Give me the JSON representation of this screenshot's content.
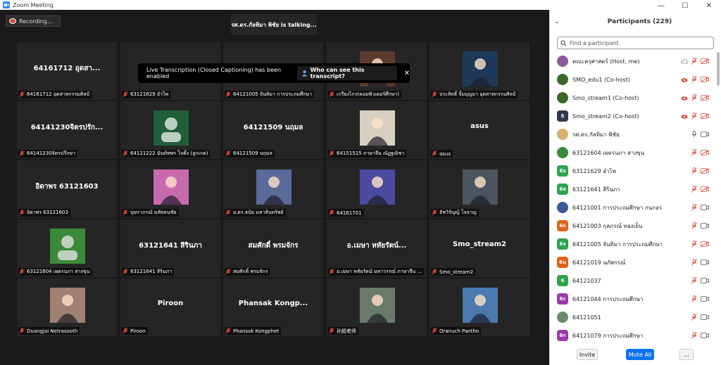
{
  "window": {
    "title": "Zoom Meeting"
  },
  "recording": {
    "label": "Recording..."
  },
  "talking": {
    "text": "รศ.ดร.กัลทิมา พิชัย is  talking..."
  },
  "banner": {
    "text": "Live Transcription (Closed Captioning) has been enabled",
    "link": "Who can see this transcript?"
  },
  "tiles": [
    {
      "big": "64161712 อุดสา...",
      "label": "64161712 อุดสาหกรรมศิลป์"
    },
    {
      "big": "",
      "label": "63121629 อำไพ"
    },
    {
      "big": "",
      "label": "64121005 จันทิมา   การประถมศึกษา"
    },
    {
      "big": "",
      "label": "เกรียงไกร(คอมพิวเตอร์ศึกษา)"
    },
    {
      "big": "",
      "label": "ประสิทธิ์   จิ้มบุญมา อุตสาหกรรมศิลป์"
    },
    {
      "big": "64141230จิตรปรัก...",
      "label": "64141230จิตรปรึกษา"
    },
    {
      "big": "",
      "label": "64121222 นันท์ทพร โจตั้ง (ลูกเกด)"
    },
    {
      "big": "64121509 นฤมล",
      "label": "64121509 นฤมล"
    },
    {
      "big": "",
      "label": "64151515 ภาษาจีน ณัฏฐณิชา"
    },
    {
      "big": "asus",
      "label": "asus"
    },
    {
      "big": "อิดาพร 63121603",
      "label": "อิดาพร 63121603"
    },
    {
      "big": "",
      "label": "บุษราภรณ์ มหัทธนชัย"
    },
    {
      "big": "",
      "label": "อ.ดร.ธนัย มหาสินทรัพย์"
    },
    {
      "big": "",
      "label": "64161701"
    },
    {
      "big": "",
      "label": "ธัชวิรัญญ์ โจจาญ"
    },
    {
      "big": "",
      "label": "63121604 เผดรนภา สางขุน"
    },
    {
      "big": "63121641 สิรินภา",
      "label": "63121641 สิรินภา"
    },
    {
      "big": "สมศักดิ์ พรมจักร",
      "label": "สมศักดิ์ พรมจักร"
    },
    {
      "big": "อ.เมษา หทัยรัตน์...",
      "label": "อ.เมษา หทัยรัตน์ มหาวรรณ์ ภาษาจีน ..."
    },
    {
      "big": "Smo_stream2",
      "label": "Smo_stream2"
    },
    {
      "big": "",
      "label": "Duangjai Netrasooth"
    },
    {
      "big": "Piroon",
      "label": "Piroon"
    },
    {
      "big": "Phansak  Kongp...",
      "label": "Phansak Kongphet"
    },
    {
      "big": "",
      "label": "孙超老师"
    },
    {
      "big": "",
      "label": "Oranuch Pantho"
    }
  ],
  "panel": {
    "title": "Participants (229)",
    "search_placeholder": "Find a participant",
    "participants": [
      {
        "name": "คณะครุศาสตร์ (Host, me)",
        "avatar": "",
        "color": "#8a5a9e"
      },
      {
        "name": "SMO_edu1 (Co-host)",
        "avatar": "",
        "color": "#3a6b2a"
      },
      {
        "name": "Smo_stream1 (Co-host)",
        "avatar": "",
        "color": "#3a6b2a"
      },
      {
        "name": "Smo_stream2 (Co-host)",
        "avatar": "S",
        "color": "#2e3a4a"
      },
      {
        "name": "รศ.ดร.กัลทิมา พิชัย",
        "avatar": "",
        "color": "#d8b070"
      },
      {
        "name": "63121604 เผดรนภา สางขุน",
        "avatar": "",
        "color": "#3a8a3a"
      },
      {
        "name": "63121629 อำไพ",
        "avatar": "6อ",
        "color": "#2ea34a"
      },
      {
        "name": "63121641 สิรินภา",
        "avatar": "6ส",
        "color": "#2ea34a"
      },
      {
        "name": "64121001 การประถมศึกษา กนกอร",
        "avatar": "",
        "color": "#3a5a9a"
      },
      {
        "name": "64121003 กุลภรณ์ ทองเย็น",
        "avatar": "6ก",
        "color": "#e0641a"
      },
      {
        "name": "64121005 จันทิมา   การประถมศึกษา",
        "avatar": "6จ",
        "color": "#2ea34a"
      },
      {
        "name": "64121019 นภัสกรณ์",
        "avatar": "6น",
        "color": "#e0641a"
      },
      {
        "name": "64121037",
        "avatar": "6",
        "color": "#2ea34a"
      },
      {
        "name": "64121044 การประถมศึกษา",
        "avatar": "6ก",
        "color": "#9a3aa8"
      },
      {
        "name": "64121051",
        "avatar": "",
        "color": "#6a8a6a"
      },
      {
        "name": "64121079 การประถมศึกษา",
        "avatar": "6ก",
        "color": "#9a3aa8"
      }
    ],
    "invite": "Invite",
    "mute_all": "Mute All",
    "more": "..."
  }
}
